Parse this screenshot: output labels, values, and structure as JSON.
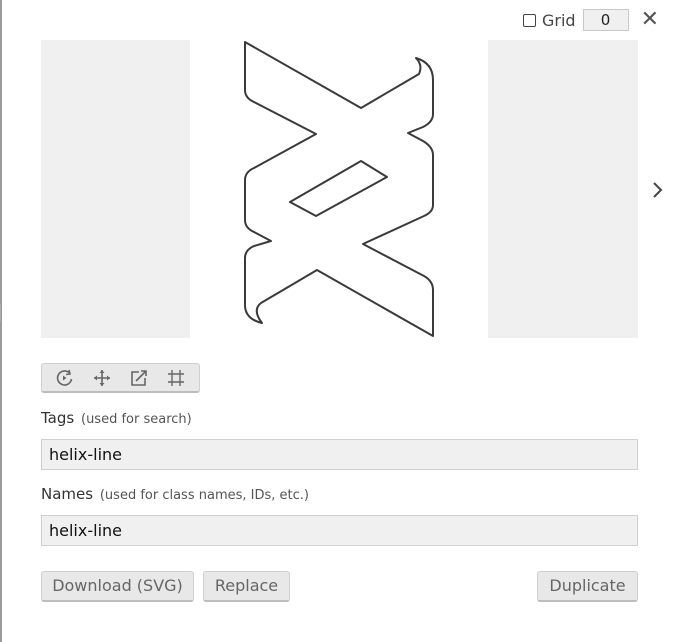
{
  "header": {
    "grid_label": "Grid",
    "grid_value": "0",
    "grid_checked": false,
    "close_icon": "close-icon"
  },
  "preview": {
    "icon_name": "helix-line",
    "next_icon": "chevron-right-icon"
  },
  "toolbar": {
    "tools": [
      "rotate-icon",
      "move-icon",
      "resize-icon",
      "crop-icon"
    ]
  },
  "tags": {
    "label": "Tags",
    "hint": "(used for search)",
    "value": "helix-line"
  },
  "names": {
    "label": "Names",
    "hint": "(used for class names, IDs, etc.)",
    "value": "helix-line"
  },
  "buttons": {
    "download": "Download (SVG)",
    "replace": "Replace",
    "duplicate": "Duplicate"
  }
}
